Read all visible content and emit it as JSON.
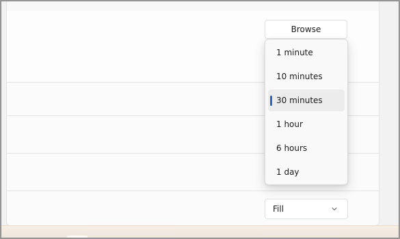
{
  "settings": {
    "browse_label": "Browse",
    "fit_value": "Fill"
  },
  "interval_menu": {
    "items": [
      {
        "label": "1 minute"
      },
      {
        "label": "10 minutes"
      },
      {
        "label": "30 minutes",
        "selected": true
      },
      {
        "label": "1 hour"
      },
      {
        "label": "6 hours"
      },
      {
        "label": "1 day"
      }
    ],
    "accent_color": "#2a64c0"
  },
  "icons": {
    "dropdown_icon": "chevron-down-icon"
  }
}
